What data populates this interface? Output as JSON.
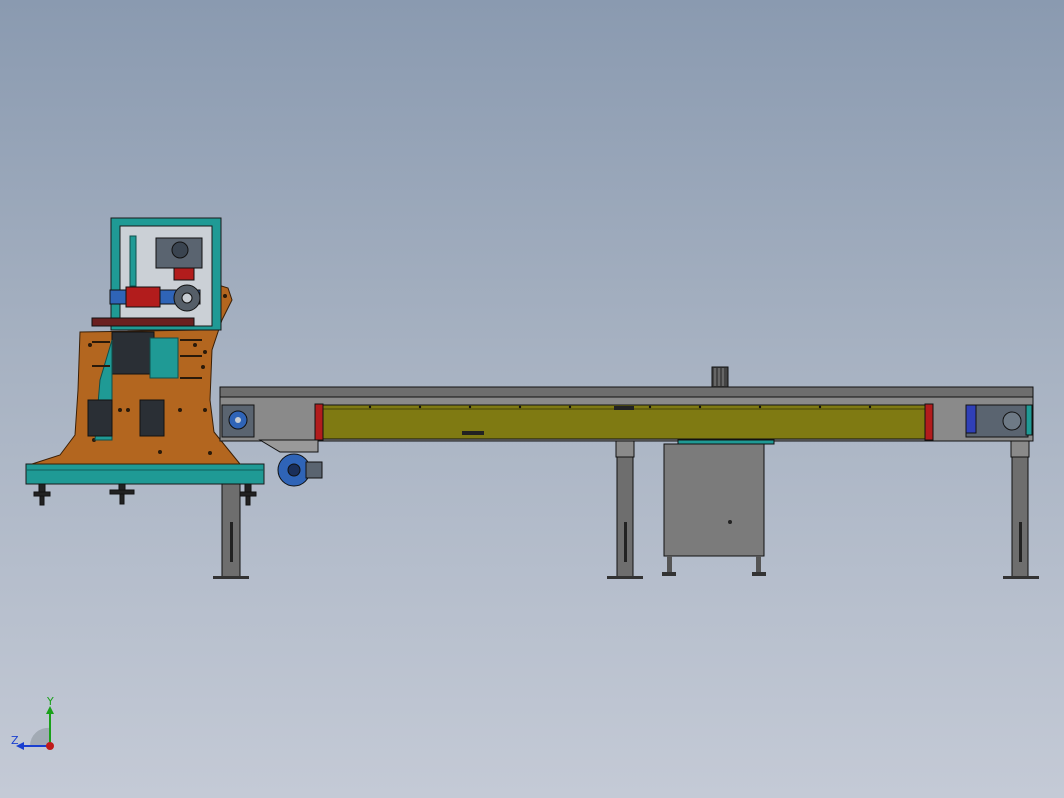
{
  "viewport": {
    "background_top": "#8a9ab0",
    "background_bottom": "#c4cad6"
  },
  "model": {
    "colors": {
      "frame_teal": "#1f9a95",
      "plate_orange": "#b3661f",
      "conveyor_olive": "#7f7a12",
      "steel_gray": "#6e6e6e",
      "motor_blue": "#2f64b7",
      "accent_red": "#b21c1c"
    }
  },
  "triad": {
    "y_label": "Y",
    "z_label": "Z",
    "y_color": "#1aa01a",
    "z_color": "#1a3fd0",
    "x_color": "#c01a1a"
  }
}
